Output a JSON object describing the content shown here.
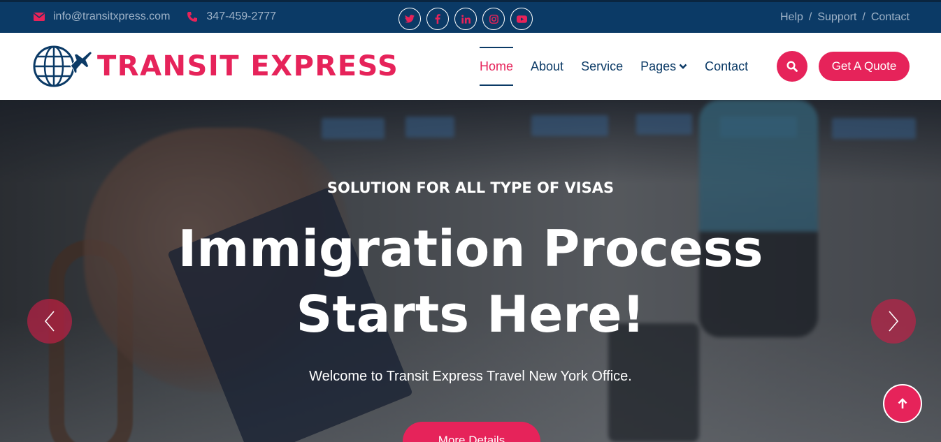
{
  "colors": {
    "brand_pink": "#e6235a",
    "navy": "#0b3a66",
    "topbar_text": "#9fb3c8"
  },
  "topbar": {
    "email": "info@transitxpress.com",
    "phone": "347-459-2777",
    "email_icon": "envelope-icon",
    "phone_icon": "phone-icon",
    "social": [
      "twitter-icon",
      "facebook-icon",
      "linkedin-icon",
      "instagram-icon",
      "youtube-icon"
    ],
    "links": [
      "Help",
      "Support",
      "Contact"
    ],
    "separator": "/"
  },
  "navbar": {
    "logo_text": "TRANSIT EXPRESS",
    "logo_icon": "globe-plane-icon",
    "menu": [
      {
        "label": "Home",
        "active": true
      },
      {
        "label": "About"
      },
      {
        "label": "Service"
      },
      {
        "label": "Pages",
        "has_dropdown": true
      },
      {
        "label": "Contact"
      }
    ],
    "search_icon": "search-icon",
    "quote_label": "Get A Quote"
  },
  "hero": {
    "subtitle": "SOLUTION FOR ALL TYPE OF VISAS",
    "headline_line1": "Immigration Process",
    "headline_line2": "Starts Here!",
    "welcome": "Welcome to Transit Express Travel New York Office.",
    "button_label": "More Details",
    "prev_icon": "chevron-left-icon",
    "next_icon": "chevron-right-icon",
    "scroll_top_icon": "arrow-up-icon"
  }
}
